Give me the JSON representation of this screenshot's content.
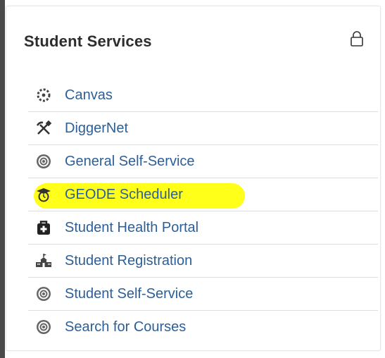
{
  "card": {
    "title": "Student Services",
    "lock_icon": "lock-icon"
  },
  "colors": {
    "link": "#2c5f97",
    "highlight": "#ffff1a",
    "divider": "#dddddd"
  },
  "items": [
    {
      "label": "Canvas",
      "icon": "canvas-icon",
      "highlighted": false
    },
    {
      "label": "DiggerNet",
      "icon": "pick-shovel-icon",
      "highlighted": false
    },
    {
      "label": "General Self-Service",
      "icon": "target-icon",
      "highlighted": false
    },
    {
      "label": "GEODE Scheduler",
      "icon": "graduation-cap-clock-icon",
      "highlighted": true
    },
    {
      "label": "Student Health Portal",
      "icon": "medical-kit-icon",
      "highlighted": false
    },
    {
      "label": "Student Registration",
      "icon": "school-building-icon",
      "highlighted": false
    },
    {
      "label": "Student Self-Service",
      "icon": "target-icon",
      "highlighted": false
    },
    {
      "label": "Search for Courses",
      "icon": "target-icon",
      "highlighted": false
    }
  ]
}
